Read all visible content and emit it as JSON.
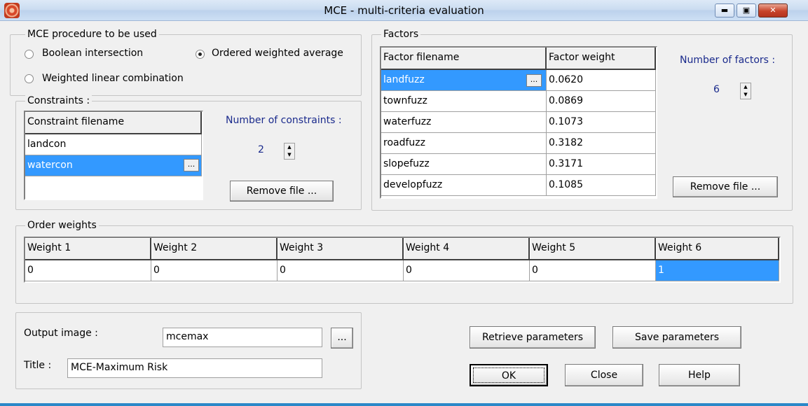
{
  "window": {
    "title": "MCE - multi-criteria evaluation"
  },
  "procedure": {
    "label": "MCE procedure to be used",
    "options": [
      "Boolean intersection",
      "Ordered weighted average",
      "Weighted linear combination"
    ],
    "selected": "Ordered weighted average"
  },
  "constraints": {
    "label": "Constraints :",
    "header": "Constraint filename",
    "rows": [
      "landcon",
      "watercon"
    ],
    "count_label": "Number of constraints :",
    "count": "2",
    "remove_label": "Remove file ..."
  },
  "factors": {
    "label": "Factors",
    "headers": [
      "Factor filename",
      "Factor weight"
    ],
    "rows": [
      {
        "name": "landfuzz",
        "weight": "0.0620"
      },
      {
        "name": "townfuzz",
        "weight": "0.0869"
      },
      {
        "name": "waterfuzz",
        "weight": "0.1073"
      },
      {
        "name": "roadfuzz",
        "weight": "0.3182"
      },
      {
        "name": "slopefuzz",
        "weight": "0.3171"
      },
      {
        "name": "developfuzz",
        "weight": "0.1085"
      }
    ],
    "count_label": "Number of factors :",
    "count": "6",
    "remove_label": "Remove file ..."
  },
  "order_weights": {
    "label": "Order weights",
    "headers": [
      "Weight 1",
      "Weight 2",
      "Weight 3",
      "Weight 4",
      "Weight 5",
      "Weight 6"
    ],
    "values": [
      "0",
      "0",
      "0",
      "0",
      "0",
      "1"
    ]
  },
  "output": {
    "image_label": "Output image :",
    "image_value": "mcemax",
    "title_label": "Title :",
    "title_value": "MCE-Maximum Risk",
    "browse_label": "..."
  },
  "buttons": {
    "retrieve": "Retrieve parameters",
    "save": "Save parameters",
    "ok": "OK",
    "close": "Close",
    "help": "Help"
  },
  "colors": {
    "selection": "#3399ff",
    "label_blue": "#1a2a8c"
  }
}
